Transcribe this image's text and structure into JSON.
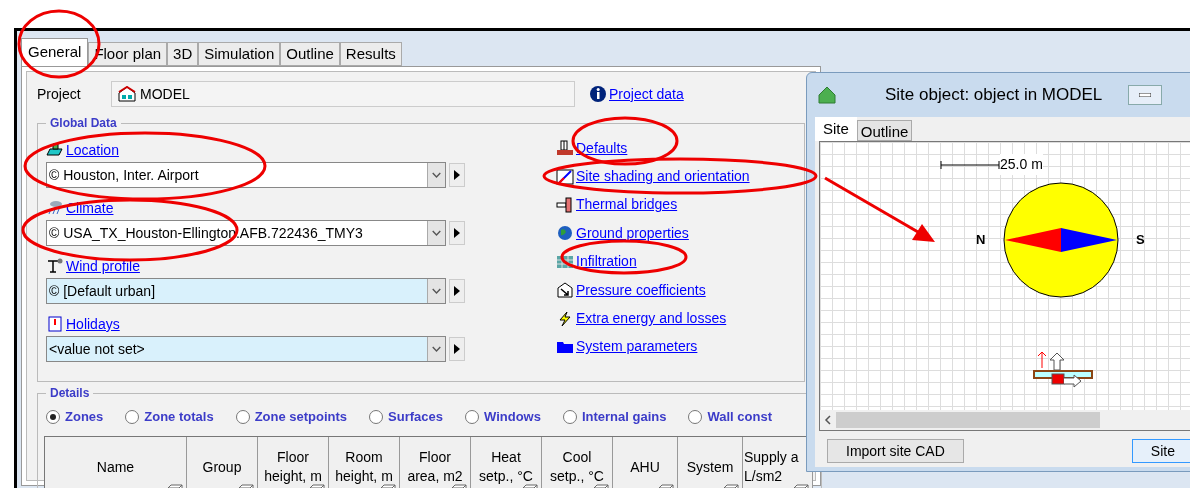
{
  "tabs": [
    {
      "label": "General",
      "selected": true
    },
    {
      "label": "Floor plan",
      "selected": false
    },
    {
      "label": "3D",
      "selected": false
    },
    {
      "label": "Simulation",
      "selected": false
    },
    {
      "label": "Outline",
      "selected": false
    },
    {
      "label": "Results",
      "selected": false
    }
  ],
  "project": {
    "label": "Project",
    "value": "MODEL"
  },
  "project_link": "Project data",
  "global_data": {
    "title": "Global Data",
    "fields": [
      {
        "link": "Location",
        "value": "© Houston, Inter. Airport",
        "highlighted": false
      },
      {
        "link": "Climate",
        "value": "© USA_TX_Houston-Ellington.AFB.722436_TMY3",
        "highlighted": false
      },
      {
        "link": "Wind profile",
        "value": "© [Default urban]",
        "highlighted": true
      },
      {
        "link": "Holidays",
        "value": "<value not set>",
        "highlighted": true
      }
    ],
    "links": [
      "Defaults",
      "Site shading and orientation",
      "Thermal bridges",
      "Ground properties",
      "Infiltration",
      "Pressure coefficients",
      "Extra energy and losses",
      "System parameters"
    ]
  },
  "details": {
    "title": "Details",
    "radios": [
      {
        "label": "Zones",
        "selected": true
      },
      {
        "label": "Zone totals",
        "selected": false
      },
      {
        "label": "Zone setpoints",
        "selected": false
      },
      {
        "label": "Surfaces",
        "selected": false
      },
      {
        "label": "Windows",
        "selected": false
      },
      {
        "label": "Internal gains",
        "selected": false
      },
      {
        "label": "Wall const",
        "selected": false
      }
    ],
    "columns": [
      [
        "Name"
      ],
      [
        "Group"
      ],
      [
        "Floor",
        "height, m"
      ],
      [
        "Room",
        "height, m"
      ],
      [
        "Floor",
        "area, m2"
      ],
      [
        "Heat",
        "setp., °C"
      ],
      [
        "Cool",
        "setp., °C"
      ],
      [
        "AHU"
      ],
      [
        "System"
      ],
      [
        "Supply a",
        "L/sm2"
      ]
    ]
  },
  "dialog": {
    "title": "Site object: object in MODEL",
    "tabs": [
      {
        "label": "Site",
        "selected": true
      },
      {
        "label": "Outline",
        "selected": false
      }
    ],
    "scale": "25.0 m",
    "north": "N",
    "south": "S",
    "buttons": [
      "Import site CAD",
      "Site"
    ]
  }
}
